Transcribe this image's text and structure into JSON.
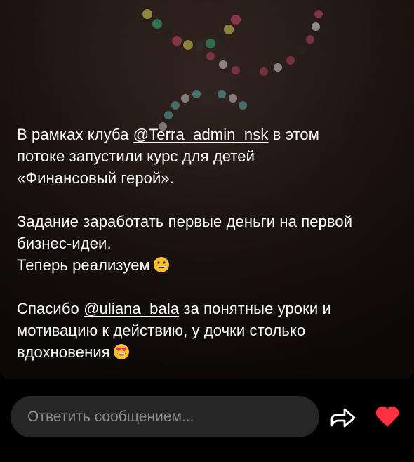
{
  "story": {
    "caption": {
      "p1_line1_pre": "В рамках клуба ",
      "p1_mention": "@Terra_admin_nsk",
      "p1_line1_post": " в этом",
      "p1_line2": "потоке запустили курс для детей",
      "p1_line3": "«Финансовый герой».",
      "p2_line1": "Задание заработать первые деньги на первой",
      "p2_line2": "бизнес-идеи.",
      "p2_line3": "Теперь реализуем",
      "p2_emoji": "grinning-sweat-emoji",
      "p3_line1_pre": "Спасибо ",
      "p3_mention": "@uliana_bala",
      "p3_line1_post": " за понятные уроки и",
      "p3_line2": "мотивацию к действию, у дочки столько",
      "p3_line3": "вдохновения",
      "p3_emoji": "heart-eyes-emoji"
    }
  },
  "reply": {
    "placeholder": "Ответить сообщением..."
  },
  "icons": {
    "share": "share-arrow-icon",
    "like": "heart-icon"
  },
  "colors": {
    "background": "#000000",
    "input_bg": "#262626",
    "placeholder": "#8e8e8e",
    "heart": "#ff3040"
  }
}
